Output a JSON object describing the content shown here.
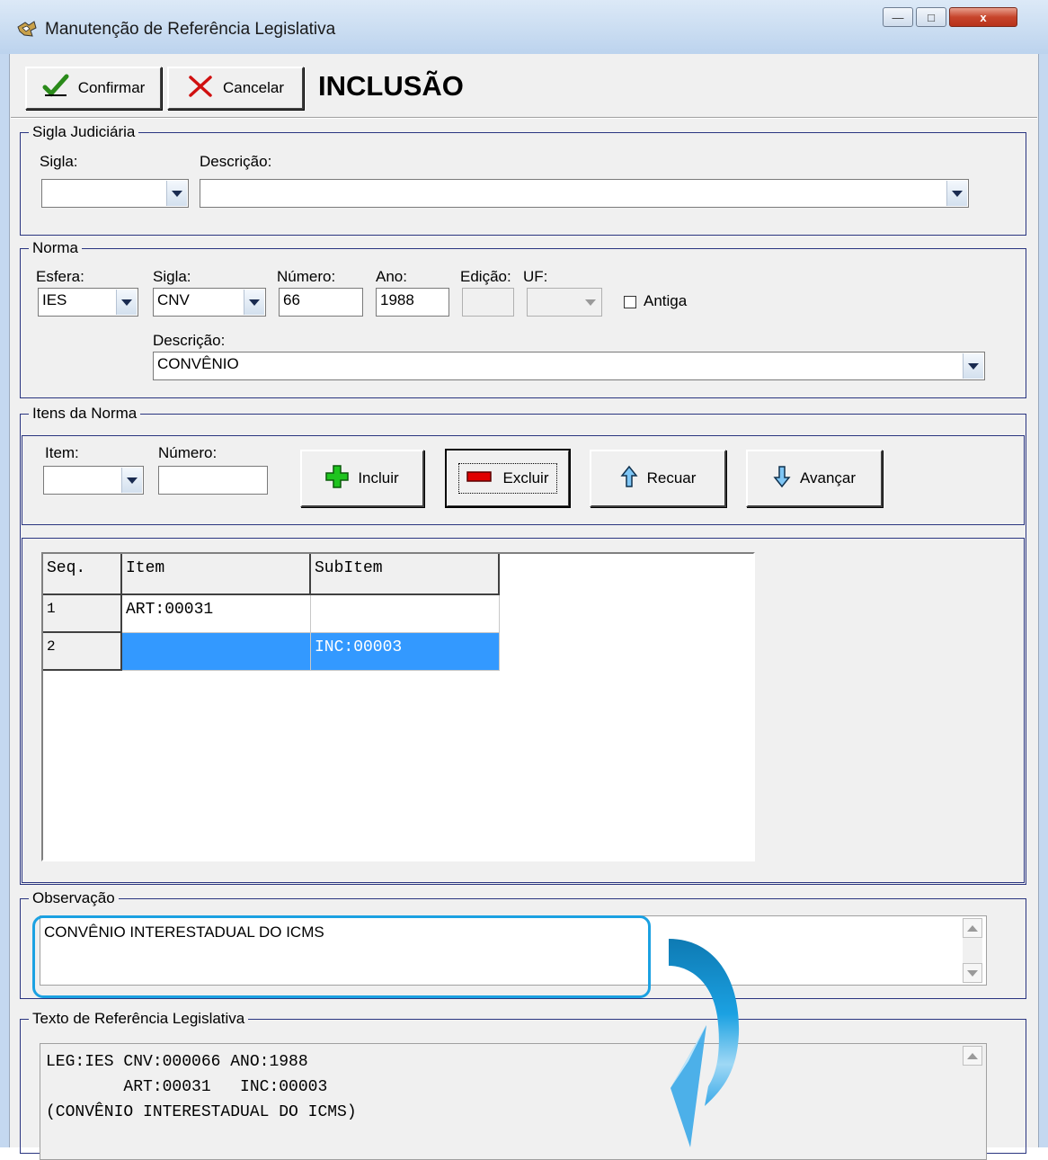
{
  "window": {
    "title": "Manutenção de Referência Legislativa",
    "minimize_label": "—",
    "maximize_label": "□",
    "close_label": "x"
  },
  "toolbar": {
    "confirm_label": "Confirmar",
    "cancel_label": "Cancelar",
    "mode": "INCLUSÃO"
  },
  "sigla_judiciaria": {
    "title": "Sigla Judiciária",
    "sigla_label": "Sigla:",
    "sigla_value": "",
    "descricao_label": "Descrição:",
    "descricao_value": ""
  },
  "norma": {
    "title": "Norma",
    "esfera_label": "Esfera:",
    "esfera_value": "IES",
    "sigla_label": "Sigla:",
    "sigla_value": "CNV",
    "numero_label": "Número:",
    "numero_value": "66",
    "ano_label": "Ano:",
    "ano_value": "1988",
    "edicao_label": "Edição:",
    "edicao_value": "",
    "uf_label": "UF:",
    "uf_value": "",
    "antiga_label": "Antiga",
    "antiga_checked": false,
    "descricao_label": "Descrição:",
    "descricao_value": "CONVÊNIO"
  },
  "itens": {
    "title": "Itens da Norma",
    "item_label": "Item:",
    "item_value": "",
    "numero_label": "Número:",
    "numero_value": "",
    "incluir_label": "Incluir",
    "excluir_label": "Excluir",
    "recuar_label": "Recuar",
    "avancar_label": "Avançar",
    "grid": {
      "columns": [
        "Seq.",
        "Item",
        "SubItem"
      ],
      "rows": [
        {
          "seq": "1",
          "item": "ART:00031",
          "subitem": ""
        },
        {
          "seq": "2",
          "item": "",
          "subitem": "INC:00003"
        }
      ],
      "selected_row": 2
    }
  },
  "observacao": {
    "title": "Observação",
    "value": "CONVÊNIO INTERESTADUAL DO ICMS"
  },
  "texto_referencia": {
    "title": "Texto de Referência Legislativa",
    "line1": "LEG:IES CNV:000066 ANO:1988",
    "line2": "        ART:00031   INC:00003",
    "line3": "(CONVÊNIO INTERESTADUAL DO ICMS)"
  },
  "colors": {
    "group_border": "#2a3580",
    "selection": "#3399ff",
    "annotation": "#1ba1e2",
    "include_icon": "#1fc41f",
    "exclude_icon": "#e00000"
  },
  "annotation": {
    "highlight_box": "observacao",
    "arrow": "curved-arrow-to-texto-referencia"
  }
}
